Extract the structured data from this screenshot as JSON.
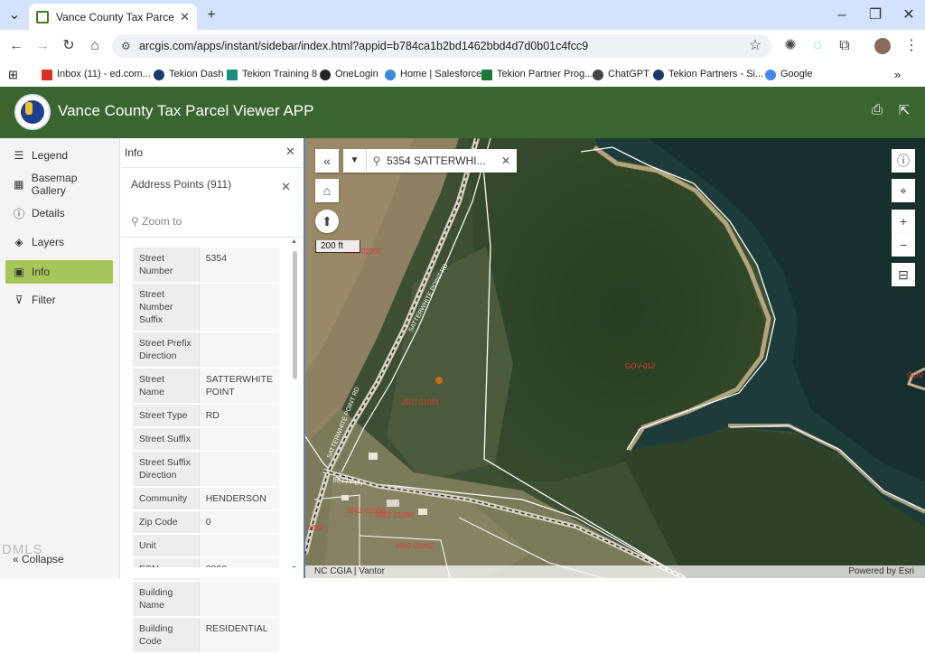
{
  "browser": {
    "tab_title": "Vance County Tax Parcel Viewer",
    "url": "arcgis.com/apps/instant/sidebar/index.html?appid=b784ca1b2bd1462bbd4d7d0b01c4fcc9",
    "bookmarks": [
      {
        "label": "Inbox (11) - ed.com...",
        "icon": "gmail-icon",
        "color": "#d93025"
      },
      {
        "label": "Tekion Dash",
        "icon": "tekion-icon",
        "color": "#1a3a6e"
      },
      {
        "label": "Tekion Training 8",
        "icon": "training-icon",
        "color": "#1e8e7e"
      },
      {
        "label": "OneLogin",
        "icon": "onelogin-icon",
        "color": "#222222"
      },
      {
        "label": "Home | Salesforce",
        "icon": "salesforce-icon",
        "color": "#3b8ad8"
      },
      {
        "label": "Tekion Partner Prog...",
        "icon": "tekion-partner-icon",
        "color": "#1a7a3a"
      },
      {
        "label": "ChatGPT",
        "icon": "chatgpt-icon",
        "color": "#444444"
      },
      {
        "label": "Tekion Partners - Si...",
        "icon": "tekion-icon",
        "color": "#1a3a6e"
      },
      {
        "label": "Google",
        "icon": "google-icon",
        "color": "#4285f4"
      }
    ]
  },
  "app": {
    "title": "Vance County Tax Parcel Viewer APP",
    "header_color": "#3b6530"
  },
  "nav": {
    "items": [
      {
        "label": "Legend",
        "icon": "legend-icon"
      },
      {
        "label": "Basemap Gallery",
        "icon": "basemap-icon"
      },
      {
        "label": "Details",
        "icon": "details-icon"
      },
      {
        "label": "Layers",
        "icon": "layers-icon"
      },
      {
        "label": "Info",
        "icon": "info-icon",
        "active": true
      },
      {
        "label": "Filter",
        "icon": "filter-icon"
      }
    ],
    "collapse_label": "Collapse",
    "active_color": "#a6c65b"
  },
  "info_panel": {
    "title": "Info",
    "layer_name": "Address Points (911)",
    "zoom_to": "Zoom to",
    "attributes": [
      {
        "key": "Street Number",
        "value": "5354"
      },
      {
        "key": "Street Number Suffix",
        "value": ""
      },
      {
        "key": "Street Prefix Direction",
        "value": ""
      },
      {
        "key": "Street Name",
        "value": "SATTERWHITE POINT"
      },
      {
        "key": "Street Type",
        "value": "RD"
      },
      {
        "key": "Street Suffix",
        "value": ""
      },
      {
        "key": "Street Suffix Direction",
        "value": ""
      },
      {
        "key": "Community",
        "value": "HENDERSON"
      },
      {
        "key": "Zip Code",
        "value": "0"
      },
      {
        "key": "Unit",
        "value": ""
      },
      {
        "key": "ESN",
        "value": "3880"
      },
      {
        "key": "Building Name",
        "value": ""
      },
      {
        "key": "Building Code",
        "value": "RESIDENTIAL"
      }
    ]
  },
  "map": {
    "search_value": "5354 SATTERWHI...",
    "scale_label": "200 ft",
    "attribution_left": "NC CGIA | Vantor",
    "attribution_right": "Powered by Esri",
    "parcel_labels": [
      "0502 02001",
      "0502 01001",
      "GOV-012",
      "0502 01058",
      "0502 01060",
      "0502 01002",
      "0200",
      "GOV"
    ],
    "road_labels": [
      "SATTERWHITE POINT RD",
      "SATTERWHITE POINT RD",
      "BETTY LN"
    ]
  },
  "watermark": "DMLS"
}
